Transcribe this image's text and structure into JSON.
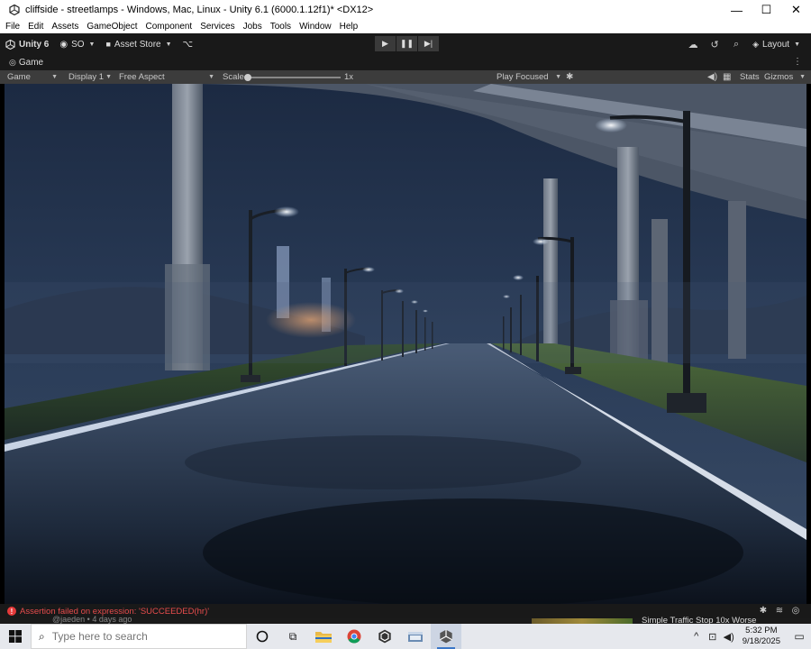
{
  "window": {
    "title": "cliffside - streetlamps - Windows, Mac, Linux - Unity 6.1 (6000.1.12f1)* <DX12>",
    "minimize": "—",
    "maximize": "☐",
    "close": "✕"
  },
  "menu": [
    "File",
    "Edit",
    "Assets",
    "GameObject",
    "Component",
    "Services",
    "Jobs",
    "Tools",
    "Window",
    "Help"
  ],
  "toolbar": {
    "unity_label": "Unity 6",
    "account_label": "SO",
    "asset_store_label": "Asset Store",
    "layout_label": "Layout"
  },
  "game_tab": {
    "label": "Game"
  },
  "game_view": {
    "view_mode": "Game",
    "display": "Display 1",
    "aspect": "Free Aspect",
    "scale_label": "Scale",
    "scale_value": "1x",
    "scale_fraction": 0.0,
    "play_mode": "Play Focused",
    "stats_label": "Stats",
    "gizmos_label": "Gizmos"
  },
  "console": {
    "error_text": "Assertion failed on expression: 'SUCCEEDED(hr)'"
  },
  "background": {
    "partial_text_left": "@jaeden • 4 days ago",
    "partial_text_right": "Simple Traffic Stop 10x Worse"
  },
  "taskbar": {
    "search_placeholder": "Type here to search",
    "time": "5:32 PM",
    "date": "9/18/2025"
  },
  "colors": {
    "editor_dark": "#191919",
    "game_toolbar": "#3c3c3c",
    "error_red": "#e74c4c",
    "taskbar": "#e6e8ed"
  }
}
